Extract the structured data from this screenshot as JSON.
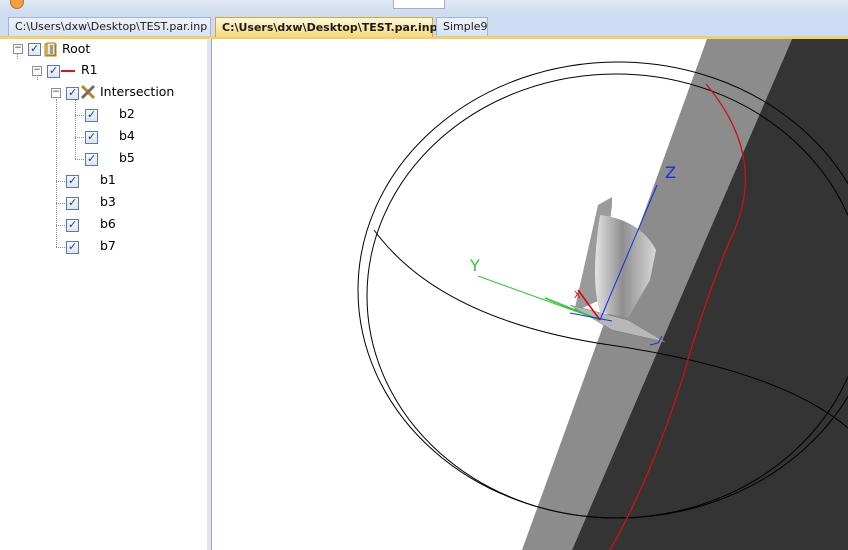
{
  "tabs": [
    {
      "label": "C:\\Users\\dxw\\Desktop\\TEST.par.inp",
      "active": false
    },
    {
      "label": "C:\\Users\\dxw\\Desktop\\TEST.par.inp",
      "active": true,
      "close": "✕"
    },
    {
      "label": "Simple9",
      "active": false
    }
  ],
  "tree": {
    "root": "Root",
    "r1": "R1",
    "intersection": "Intersection",
    "intersection_children": [
      "b2",
      "b4",
      "b5"
    ],
    "r1_children": [
      "b1",
      "b3",
      "b6",
      "b7"
    ]
  },
  "viewport": {
    "axes": {
      "x": "X",
      "y": "Y",
      "z": "Z"
    },
    "colors": {
      "x_axis": "#e00000",
      "y_axis": "#2ec82e",
      "z_axis": "#1530e0",
      "dark_plane": "#343434",
      "light_plane": "#8c8c8c",
      "red_curve": "#d01010"
    }
  },
  "icons": [
    "folder-icon",
    "line-icon",
    "intersection-icon",
    "expander-icon",
    "checkbox-icon"
  ]
}
